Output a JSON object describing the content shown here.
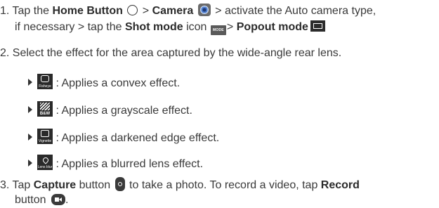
{
  "step1": {
    "num": "1.",
    "t1": "Tap the ",
    "home": "Home Button",
    "t2": " > ",
    "camera": "Camera",
    "t3": " > activate the Auto camera type,",
    "t4": "if necessary > tap the ",
    "shot": "Shot mode",
    "t5": " icon ",
    "mode_icon_text": "MODE",
    "t6": "> ",
    "popout": "Popout mode"
  },
  "step2": {
    "num": "2.",
    "text": "Select the effect for the area captured by the wide-angle rear lens."
  },
  "effects": [
    {
      "icon": "fisheye-icon",
      "caption": "Fisheye",
      "desc": ": Applies a convex effect."
    },
    {
      "icon": "bw-icon",
      "caption": "B&W",
      "desc": ": Applies a grayscale effect."
    },
    {
      "icon": "vignette-icon",
      "caption": "Vignette",
      "desc": ": Applies a darkened edge effect."
    },
    {
      "icon": "lens-blur-icon",
      "caption": "Lens blur",
      "desc": ": Applies a blurred lens effect."
    }
  ],
  "step3": {
    "num": "3.",
    "t1": "Tap ",
    "capture": "Capture",
    "t2": " button ",
    "t3": " to take a photo. To record a video, tap ",
    "record": "Record",
    "t4": "button "
  },
  "colors": {
    "text": "#3a3a3a",
    "icon_bg": "#2a2a2a"
  }
}
